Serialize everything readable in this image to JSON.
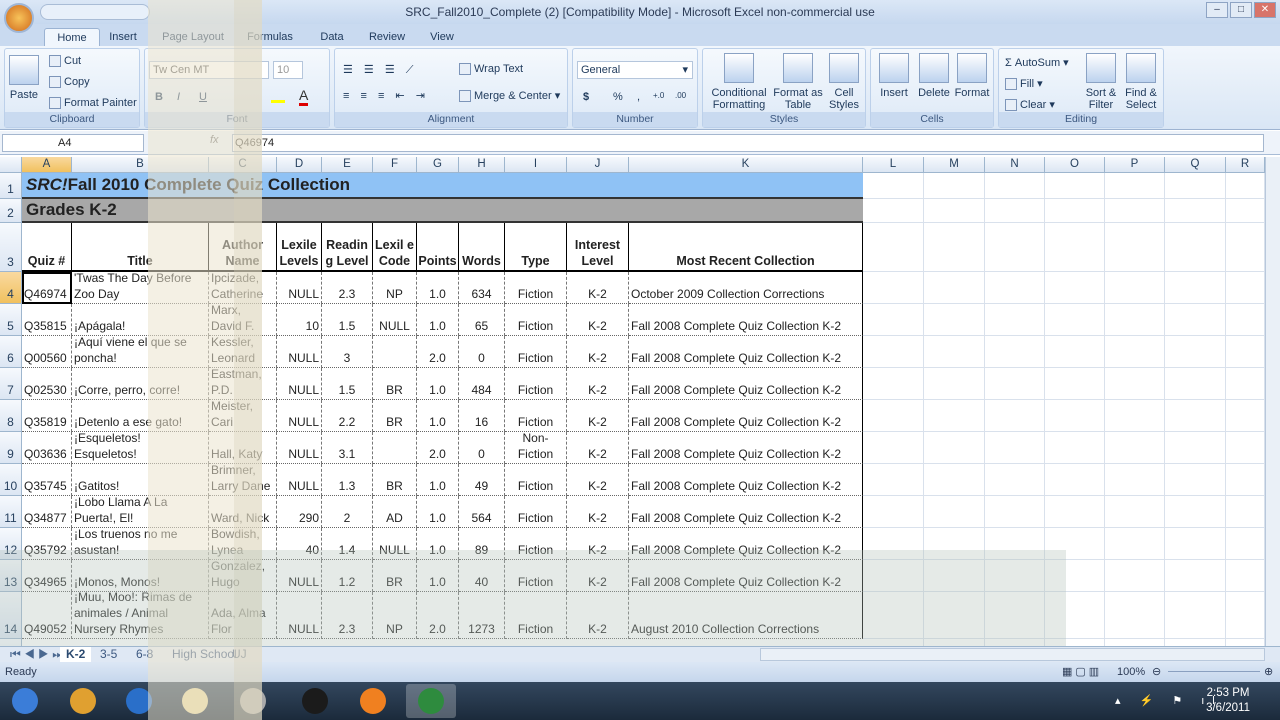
{
  "window": {
    "title": "SRC_Fall2010_Complete (2)  [Compatibility Mode] - Microsoft Excel non-commercial use",
    "min": "–",
    "max": "□",
    "close": "✕"
  },
  "ribbon_tabs": [
    "Home",
    "Insert",
    "Page Layout",
    "Formulas",
    "Data",
    "Review",
    "View"
  ],
  "clipboard": {
    "paste": "Paste",
    "cut": "Cut",
    "copy": "Copy",
    "format_painter": "Format Painter",
    "label": "Clipboard"
  },
  "font": {
    "name": "Tw Cen MT",
    "size": "10",
    "bold": "B",
    "italic": "I",
    "underline": "U",
    "label": "Font"
  },
  "alignment": {
    "wrap": "Wrap Text",
    "merge": "Merge & Center",
    "label": "Alignment"
  },
  "number": {
    "format": "General",
    "currency": "$",
    "percent": "%",
    "comma": ",",
    "inc": "+.0",
    "dec": ".00",
    "label": "Number"
  },
  "styles": {
    "conditional": "Conditional Formatting",
    "format_table": "Format as Table",
    "cell_styles": "Cell Styles",
    "label": "Styles"
  },
  "cells": {
    "insert": "Insert",
    "delete": "Delete",
    "format": "Format",
    "label": "Cells"
  },
  "editing": {
    "autosum": "AutoSum",
    "fill": "Fill",
    "clear": "Clear",
    "sort": "Sort & Filter",
    "find": "Find & Select",
    "label": "Editing"
  },
  "formula_bar": {
    "name_box": "A4",
    "fx": "fx",
    "value": "Q46974"
  },
  "columns": [
    "A",
    "B",
    "C",
    "D",
    "E",
    "F",
    "G",
    "H",
    "I",
    "J",
    "K",
    "L",
    "M",
    "N",
    "O",
    "P",
    "Q",
    "R"
  ],
  "sheet": {
    "title_italic": "SRC!",
    "title": " Fall 2010 Complete Quiz Collection",
    "subtitle": "Grades K-2",
    "headers": [
      "Quiz #",
      "Title",
      "Author Name",
      "Lexile Levels",
      "Readin g Level",
      "Lexil e Code",
      "Points",
      "Words",
      "Type",
      "Interest Level",
      "Most Recent Collection"
    ],
    "rows": [
      [
        "Q46974",
        "'Twas The Day Before Zoo Day",
        "Ipcizade, Catherine",
        "NULL",
        "2.3",
        "NP",
        "1.0",
        "634",
        "Fiction",
        "K-2",
        "October 2009 Collection Corrections"
      ],
      [
        "Q35815",
        "¡Apágala!",
        "Marx, David F.",
        "10",
        "1.5",
        "NULL",
        "1.0",
        "65",
        "Fiction",
        "K-2",
        "Fall 2008 Complete Quiz Collection K-2"
      ],
      [
        "Q00560",
        "¡Aquí viene el que se poncha!",
        "Kessler, Leonard",
        "NULL",
        "3",
        "",
        "2.0",
        "0",
        "Fiction",
        "K-2",
        "Fall 2008 Complete Quiz Collection K-2"
      ],
      [
        "Q02530",
        "¡Corre, perro, corre!",
        "Eastman, P.D.",
        "NULL",
        "1.5",
        "BR",
        "1.0",
        "484",
        "Fiction",
        "K-2",
        "Fall 2008 Complete Quiz Collection K-2"
      ],
      [
        "Q35819",
        "¡Detenlo a ese gato!",
        "Meister, Cari",
        "NULL",
        "2.2",
        "BR",
        "1.0",
        "16",
        "Fiction",
        "K-2",
        "Fall 2008 Complete Quiz Collection K-2"
      ],
      [
        "Q03636",
        "¡Esqueletos! Esqueletos!",
        "Hall, Katy",
        "NULL",
        "3.1",
        "",
        "2.0",
        "0",
        "Non-Fiction",
        "K-2",
        "Fall 2008 Complete Quiz Collection K-2"
      ],
      [
        "Q35745",
        "¡Gatitos!",
        "Brimner, Larry Dane",
        "NULL",
        "1.3",
        "BR",
        "1.0",
        "49",
        "Fiction",
        "K-2",
        "Fall 2008 Complete Quiz Collection K-2"
      ],
      [
        "Q34877",
        "¡Lobo Llama A La Puerta!, El!",
        "Ward, Nick",
        "290",
        "2",
        "AD",
        "1.0",
        "564",
        "Fiction",
        "K-2",
        "Fall 2008 Complete Quiz Collection K-2"
      ],
      [
        "Q35792",
        "¡Los truenos no me asustan!",
        "Bowdish, Lynea",
        "40",
        "1.4",
        "NULL",
        "1.0",
        "89",
        "Fiction",
        "K-2",
        "Fall 2008 Complete Quiz Collection K-2"
      ],
      [
        "Q34965",
        "¡Monos, Monos!",
        "Gonzalez, Hugo",
        "NULL",
        "1.2",
        "BR",
        "1.0",
        "40",
        "Fiction",
        "K-2",
        "Fall 2008 Complete Quiz Collection K-2"
      ],
      [
        "Q49052",
        "¡Muu, Moo!: Rimas de animales / Animal Nursery Rhymes",
        "Ada, Alma Flor",
        "NULL",
        "2.3",
        "NP",
        "2.0",
        "1273",
        "Fiction",
        "K-2",
        "August 2010 Collection Corrections"
      ]
    ]
  },
  "sheet_tabs": [
    "K-2",
    "3-5",
    "6-8",
    "High School",
    "UJ"
  ],
  "status": {
    "ready": "Ready",
    "zoom": "100%"
  },
  "taskbar": {
    "time": "2:53 PM",
    "date": "3/6/2011",
    "apps": [
      "start-icon",
      "chrome-icon",
      "ie-icon",
      "explorer-icon",
      "media-icon",
      "hp-icon",
      "blender-icon",
      "excel-icon"
    ]
  },
  "colors": {
    "title_band": "#8fc2f5",
    "grade_band": "#a8a8a8",
    "selected_header": "#f1c15f"
  }
}
